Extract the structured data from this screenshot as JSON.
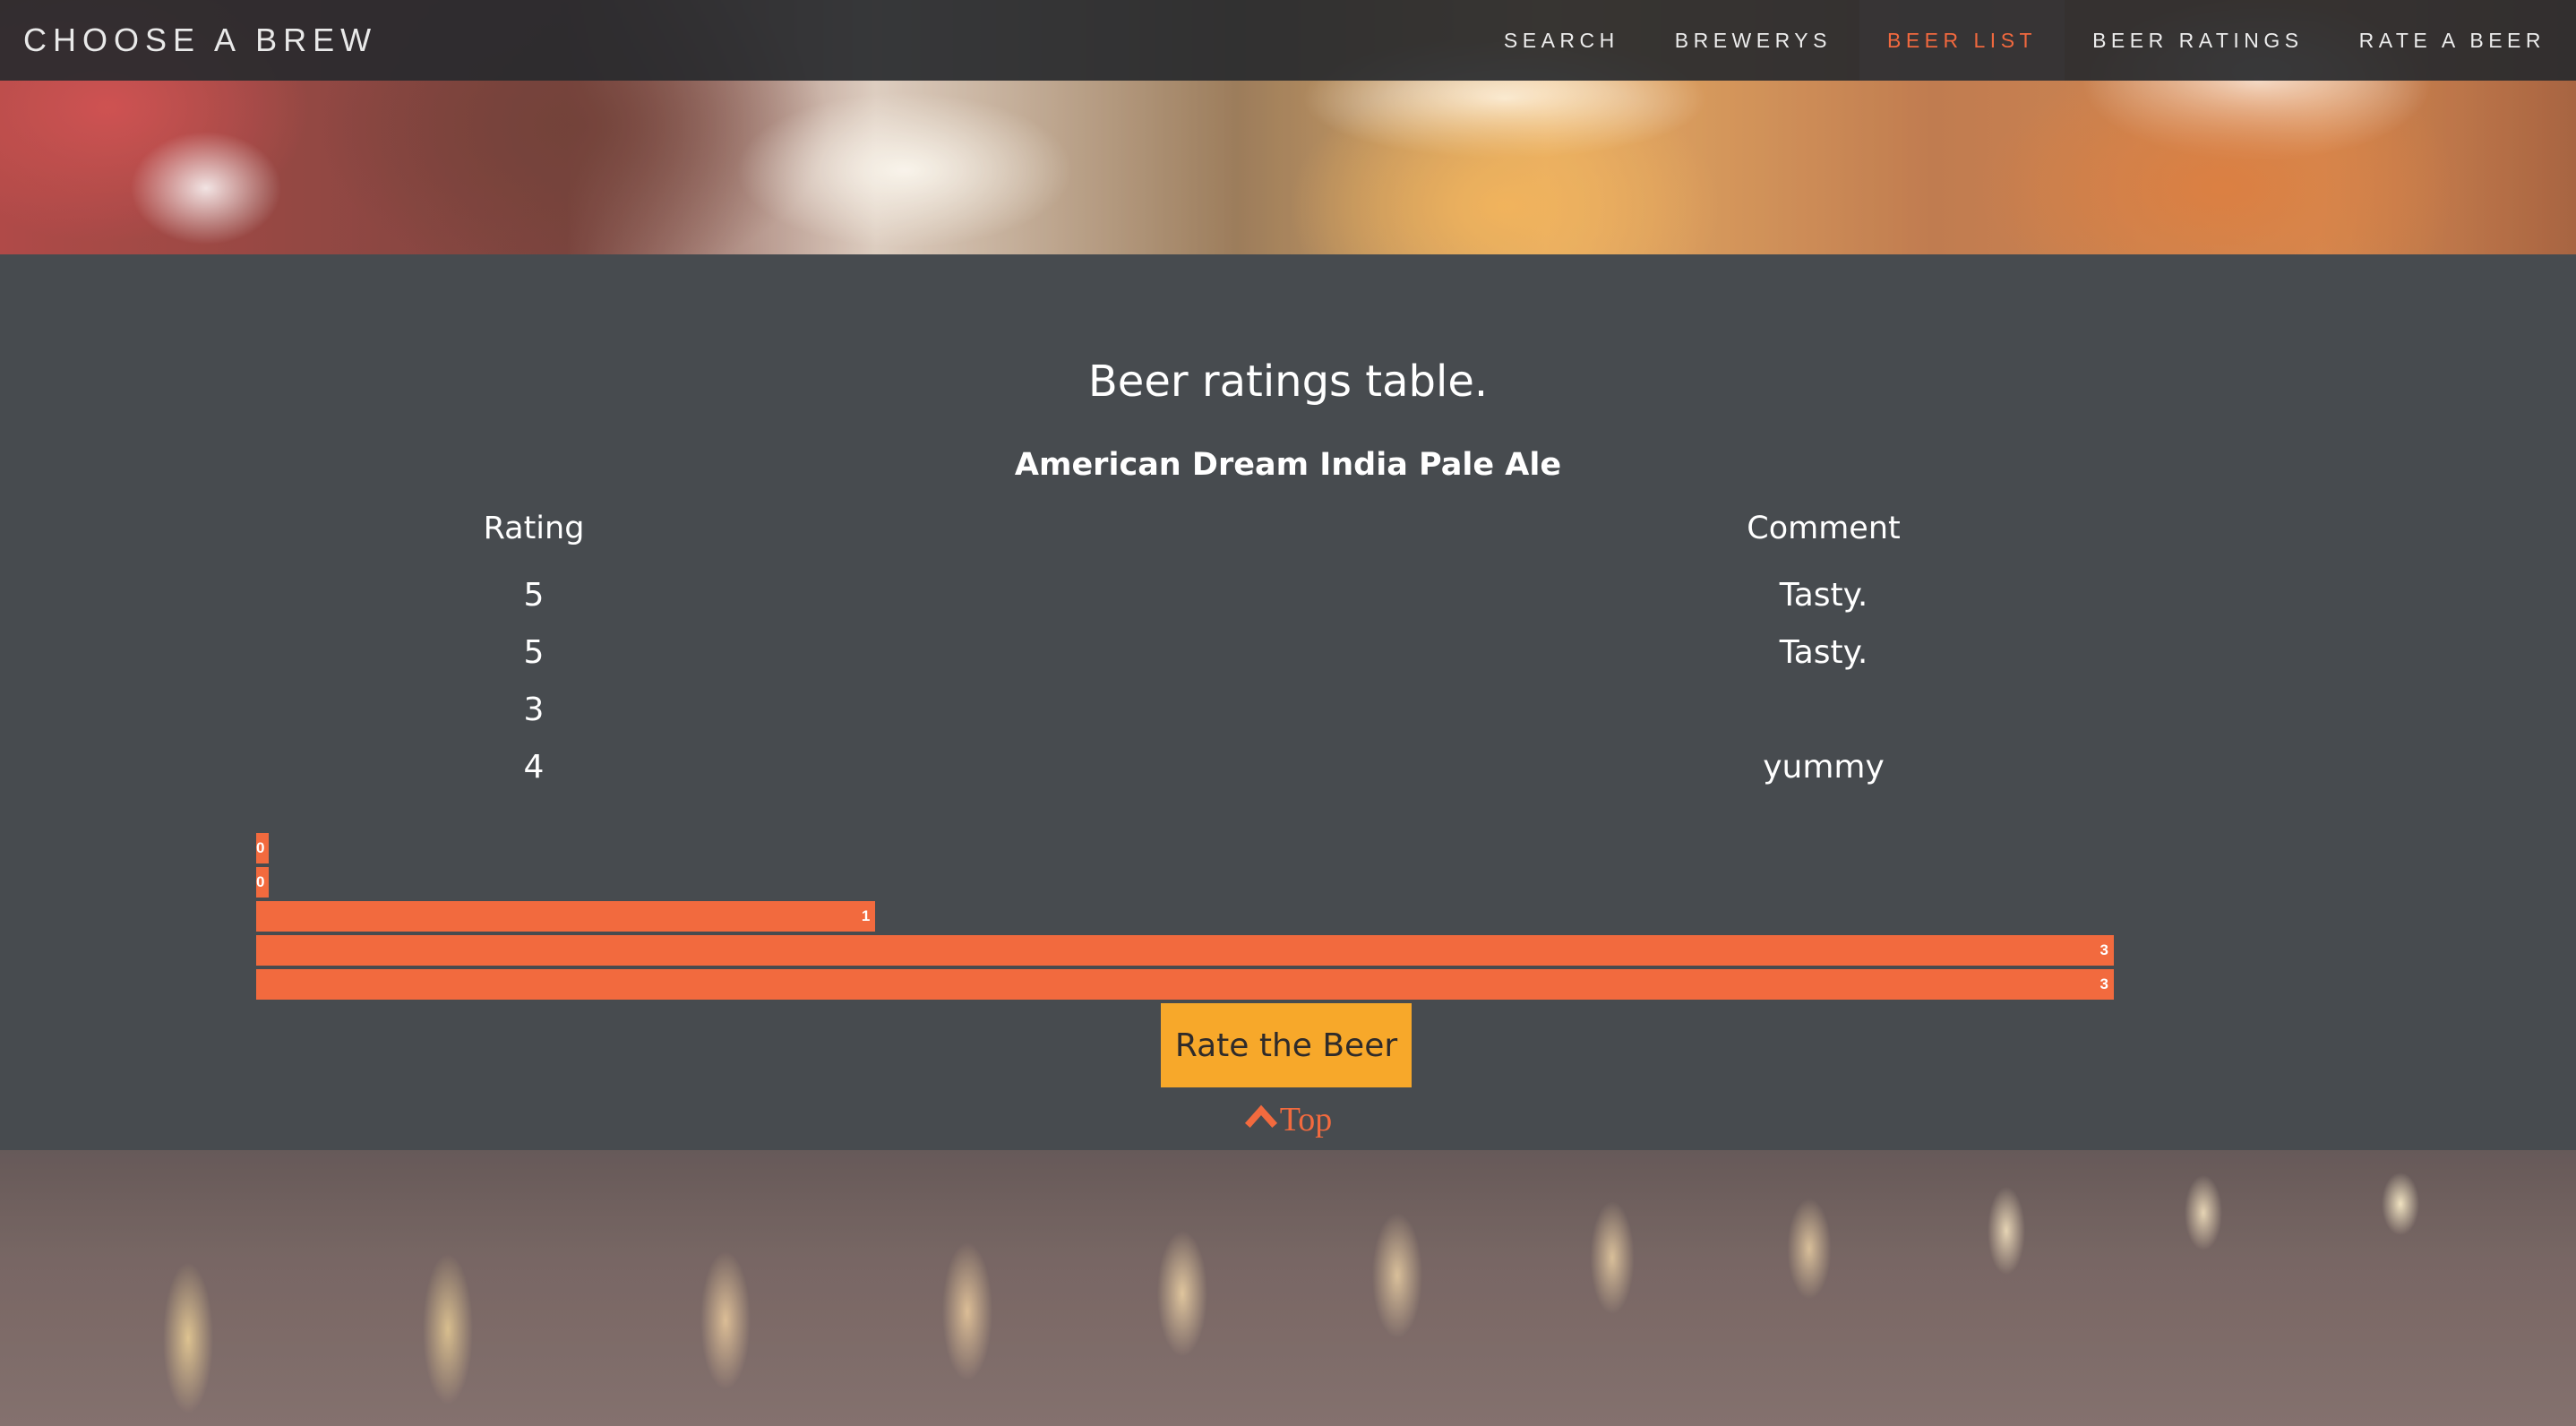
{
  "nav": {
    "brand": "CHOOSE A BREW",
    "links": [
      {
        "label": "SEARCH",
        "active": false
      },
      {
        "label": "BREWERYS",
        "active": false
      },
      {
        "label": "BEER LIST",
        "active": true
      },
      {
        "label": "BEER RATINGS",
        "active": false
      },
      {
        "label": "RATE A BEER",
        "active": false
      }
    ]
  },
  "main": {
    "title": "Beer ratings table.",
    "beer_name": "American Dream India Pale Ale",
    "columns": {
      "rating": "Rating",
      "comment": "Comment"
    },
    "rows": [
      {
        "rating": "5",
        "comment": "Tasty."
      },
      {
        "rating": "5",
        "comment": "Tasty."
      },
      {
        "rating": "3",
        "comment": ""
      },
      {
        "rating": "4",
        "comment": "yummy"
      }
    ],
    "rate_button": "Rate the Beer",
    "top_link": "Top"
  },
  "chart_data": {
    "type": "bar",
    "orientation": "horizontal",
    "values": [
      0,
      0,
      1,
      3,
      3
    ],
    "xlim": [
      0,
      3
    ],
    "color": "#f26a3e"
  },
  "colors": {
    "accent": "#f26a3e",
    "button": "#f7a82a",
    "background": "#474b4f",
    "navbar": "#2a2c2f"
  }
}
